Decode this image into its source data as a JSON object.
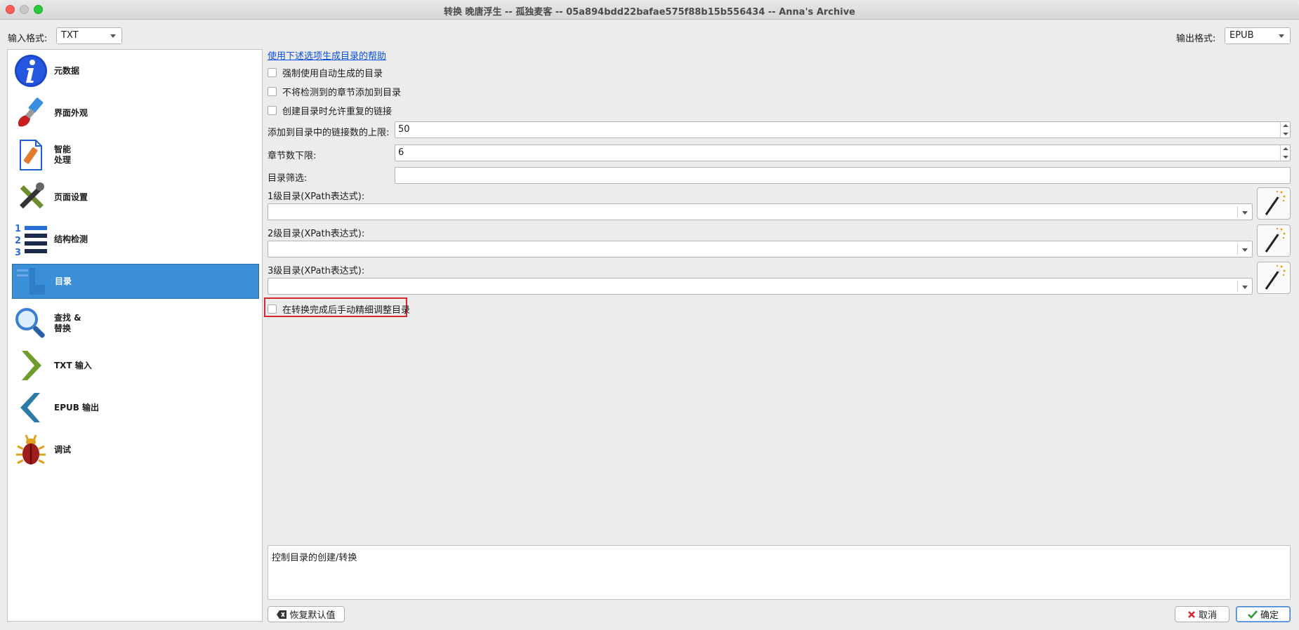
{
  "window": {
    "title": "转换 晚唐浮生 -- 孤独麦客 -- 05a894bdd22bafae575f88b15b556434 -- Anna's Archive"
  },
  "input_format": {
    "label": "输入格式:",
    "value": "TXT"
  },
  "output_format": {
    "label": "输出格式:",
    "value": "EPUB"
  },
  "sidebar": {
    "items": [
      {
        "label": "元数据",
        "icon": "info-icon"
      },
      {
        "label": "界面外观",
        "icon": "paintbrush-icon"
      },
      {
        "label": "智能\n处理",
        "icon": "document-icon"
      },
      {
        "label": "页面设置",
        "icon": "tools-icon"
      },
      {
        "label": "结构检测",
        "icon": "numbered-list-icon"
      },
      {
        "label": "目录",
        "icon": "toc-icon",
        "active": true
      },
      {
        "label": "查找 &\n替换",
        "icon": "magnifier-icon"
      },
      {
        "label": "TXT 输入",
        "icon": "chevron-right-icon"
      },
      {
        "label": "EPUB 输出",
        "icon": "chevron-left-icon"
      },
      {
        "label": "调试",
        "icon": "bug-icon"
      }
    ]
  },
  "toc": {
    "help_link": "使用下述选项生成目录的帮助",
    "checkbox_force": "强制使用自动生成的目录",
    "checkbox_no_chapters": "不将检测到的章节添加到目录",
    "checkbox_duplicates": "创建目录时允许重复的链接",
    "max_links_label": "添加到目录中的链接数的上限:",
    "max_links_value": "50",
    "chapter_threshold_label": "章节数下限:",
    "chapter_threshold_value": "6",
    "toc_filter_label": "目录筛选:",
    "level1_label": "1级目录(XPath表达式):",
    "level2_label": "2级目录(XPath表达式):",
    "level3_label": "3级目录(XPath表达式):",
    "checkbox_manual": "在转换完成后手动精细调整目录"
  },
  "description": "控制目录的创建/转换",
  "buttons": {
    "restore": "恢复默认值",
    "cancel": "取消",
    "ok": "确定"
  }
}
